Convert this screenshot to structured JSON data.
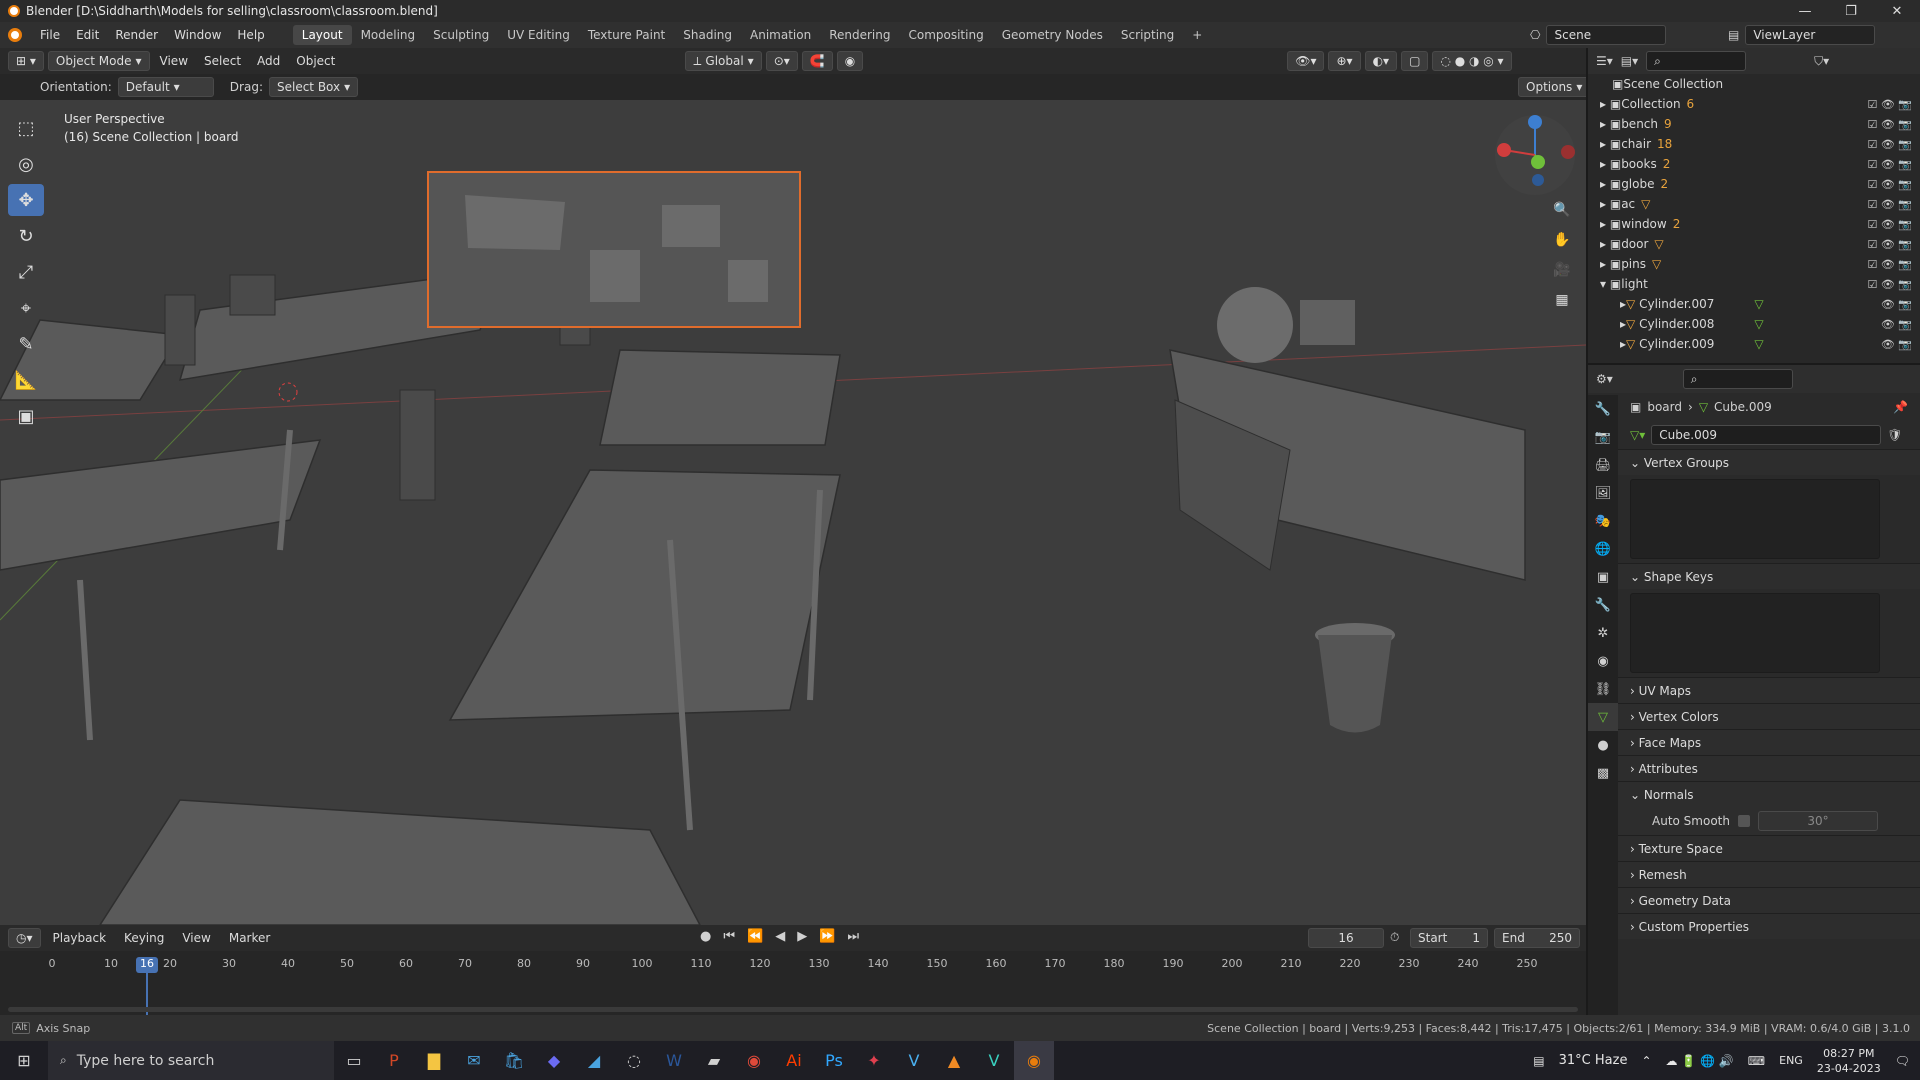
{
  "title_bar": {
    "title": "Blender [D:\\Siddharth\\Models for selling\\classroom\\classroom.blend]"
  },
  "menu": {
    "items": [
      "File",
      "Edit",
      "Render",
      "Window",
      "Help"
    ],
    "workspaces": [
      "Layout",
      "Modeling",
      "Sculpting",
      "UV Editing",
      "Texture Paint",
      "Shading",
      "Animation",
      "Rendering",
      "Compositing",
      "Geometry Nodes",
      "Scripting"
    ],
    "active_workspace": "Layout",
    "scene": "Scene",
    "view_layer": "ViewLayer"
  },
  "viewport_header": {
    "mode": "Object Mode",
    "view": "View",
    "select": "Select",
    "add": "Add",
    "object": "Object",
    "transform": "Global"
  },
  "tool_header": {
    "orientation_label": "Orientation:",
    "orientation_value": "Default",
    "drag_label": "Drag:",
    "drag_value": "Select Box",
    "options": "Options"
  },
  "viewport": {
    "perspective": "User Perspective",
    "context": "(16) Scene Collection | board"
  },
  "outliner": {
    "root": "Scene Collection",
    "items": [
      {
        "name": "Collection",
        "badge": "6"
      },
      {
        "name": "bench",
        "badge": "9"
      },
      {
        "name": "chair",
        "badge": "18"
      },
      {
        "name": "books",
        "badge": "2"
      },
      {
        "name": "globe",
        "badge": "2"
      },
      {
        "name": "ac",
        "badge": ""
      },
      {
        "name": "window",
        "badge": "2"
      },
      {
        "name": "door",
        "badge": ""
      },
      {
        "name": "pins",
        "badge": ""
      },
      {
        "name": "light",
        "badge": ""
      }
    ],
    "children": [
      "Cylinder.007",
      "Cylinder.008",
      "Cylinder.009"
    ]
  },
  "properties": {
    "breadcrumb_object": "board",
    "breadcrumb_mesh": "Cube.009",
    "mesh_name": "Cube.009",
    "panels": [
      "Vertex Groups",
      "Shape Keys",
      "UV Maps",
      "Vertex Colors",
      "Face Maps",
      "Attributes",
      "Normals",
      "Texture Space",
      "Remesh",
      "Geometry Data",
      "Custom Properties"
    ],
    "auto_smooth_label": "Auto Smooth",
    "auto_smooth_angle": "30°"
  },
  "timeline": {
    "playback": "Playback",
    "keying": "Keying",
    "view": "View",
    "marker": "Marker",
    "current_frame": "16",
    "start_label": "Start",
    "start": "1",
    "end_label": "End",
    "end": "250",
    "ticks": [
      "0",
      "10",
      "20",
      "30",
      "40",
      "50",
      "60",
      "70",
      "80",
      "90",
      "100",
      "110",
      "120",
      "130",
      "140",
      "150",
      "160",
      "170",
      "180",
      "190",
      "200",
      "210",
      "220",
      "230",
      "240",
      "250"
    ]
  },
  "status": {
    "left": "Axis Snap",
    "right": "Scene Collection | board | Verts:9,253 | Faces:8,442 | Tris:17,475 | Objects:2/61 | Memory: 334.9 MiB | VRAM: 0.6/4.0 GiB | 3.1.0"
  },
  "taskbar": {
    "search_placeholder": "Type here to search",
    "weather": "31°C  Haze",
    "lang": "ENG",
    "time": "08:27 PM",
    "date": "23-04-2023"
  }
}
